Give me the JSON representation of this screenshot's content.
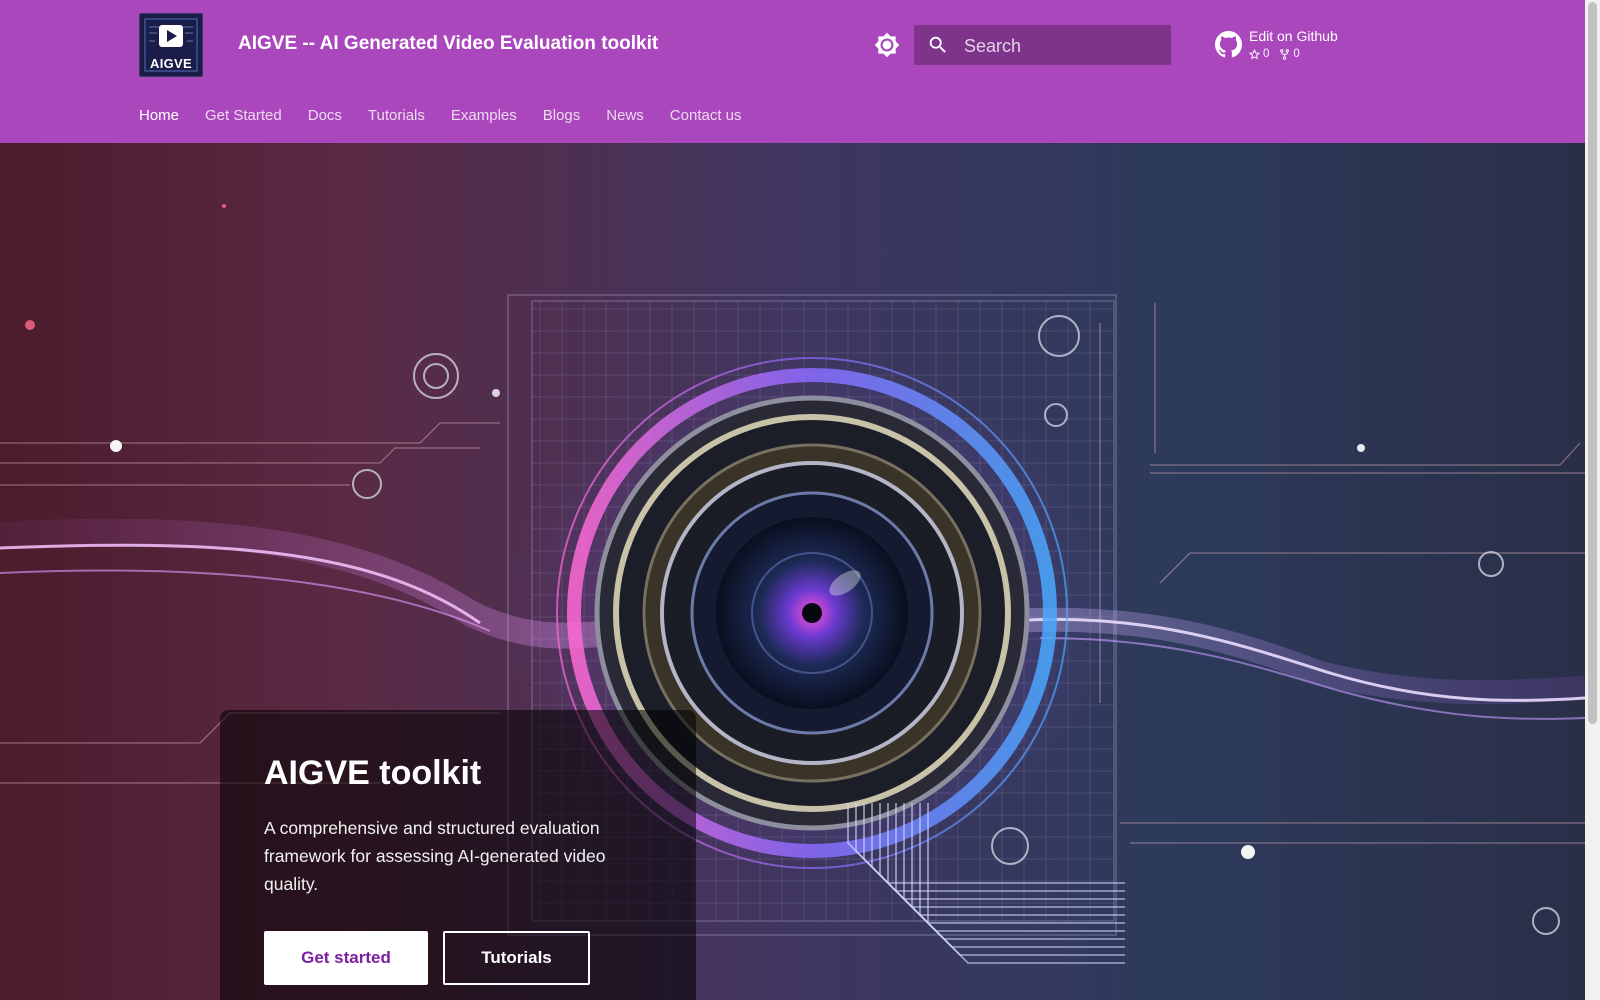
{
  "header": {
    "logo_text": "AIGVE",
    "site_title": "AIGVE -- AI Generated Video Evaluation toolkit",
    "search": {
      "placeholder": "Search"
    },
    "repo": {
      "label": "Edit on Github",
      "stars": "0",
      "forks": "0"
    },
    "icons": {
      "theme_toggle": "brightness-icon",
      "search": "search-icon",
      "github": "github-icon",
      "star": "star-icon",
      "fork": "fork-icon"
    }
  },
  "nav": {
    "items": [
      {
        "label": "Home",
        "active": true
      },
      {
        "label": "Get Started",
        "active": false
      },
      {
        "label": "Docs",
        "active": false
      },
      {
        "label": "Tutorials",
        "active": false
      },
      {
        "label": "Examples",
        "active": false
      },
      {
        "label": "Blogs",
        "active": false
      },
      {
        "label": "News",
        "active": false
      },
      {
        "label": "Contact us",
        "active": false
      }
    ]
  },
  "hero": {
    "title": "AIGVE toolkit",
    "description": "A comprehensive and structured evaluation framework for assessing AI-generated video quality.",
    "primary_button": "Get started",
    "secondary_button": "Tutorials"
  },
  "colors": {
    "header_bg": "#ab47bc",
    "primary_button_text": "#7b1fa2"
  }
}
